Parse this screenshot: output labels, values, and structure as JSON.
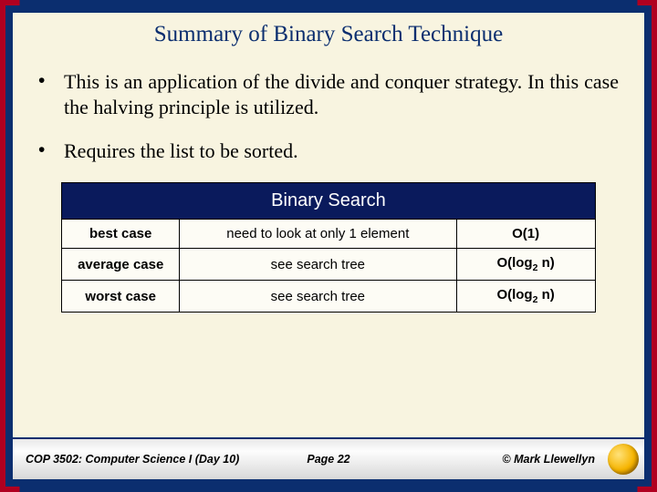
{
  "title": "Summary of Binary Search Technique",
  "bullets": [
    "This is an application of the divide and conquer strategy.  In this case the halving principle is utilized.",
    "Requires the list to be sorted."
  ],
  "table": {
    "header": "Binary Search",
    "rows": [
      {
        "case": "best case",
        "desc": "need to look at only 1 element",
        "bigO": "O(1)"
      },
      {
        "case": "average case",
        "desc": "see search tree",
        "bigO_html": "O(log<sub>2</sub> n)"
      },
      {
        "case": "worst case",
        "desc": "see search tree",
        "bigO_html": "O(log<sub>2</sub> n)"
      }
    ]
  },
  "footer": {
    "left": "COP 3502: Computer Science I  (Day 10)",
    "center": "Page 22",
    "right": "© Mark Llewellyn"
  }
}
